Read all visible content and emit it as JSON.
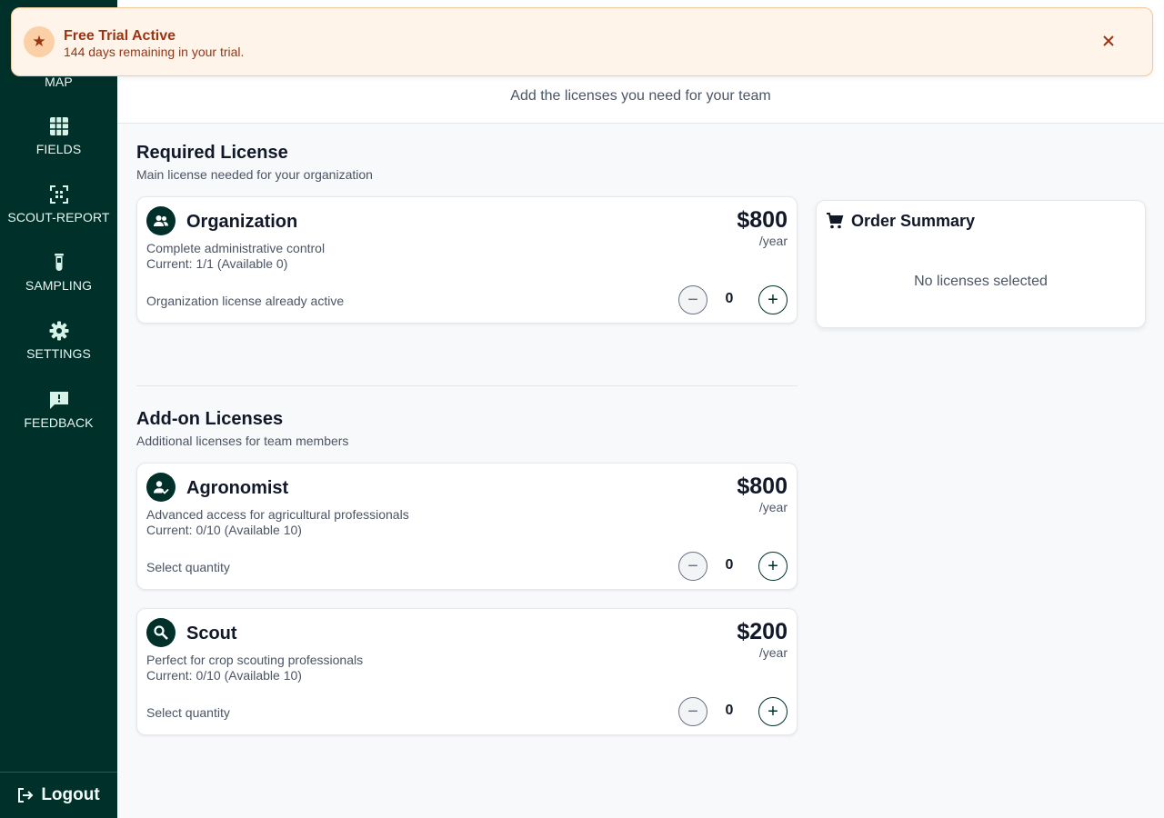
{
  "banner": {
    "title": "Free Trial Active",
    "text": "144 days remaining in your trial.",
    "icon": "star-icon",
    "close_icon": "close-icon",
    "color": "#9a3412",
    "background": "#fff4ea"
  },
  "sidebar": {
    "background": "#00302a",
    "items": [
      {
        "label": "MAP",
        "icon": "map-icon"
      },
      {
        "label": "FIELDS",
        "icon": "grid-icon"
      },
      {
        "label": "SCOUT-REPORT",
        "icon": "scan-icon"
      },
      {
        "label": "SAMPLING",
        "icon": "test-tube-icon"
      },
      {
        "label": "SETTINGS",
        "icon": "gear-icon"
      },
      {
        "label": "FEEDBACK",
        "icon": "feedback-icon"
      }
    ],
    "logout_label": "Logout",
    "logout_icon": "logout-icon"
  },
  "header": {
    "title": "",
    "subtitle": "Add the licenses you need for your team"
  },
  "required_section": {
    "title": "Required License",
    "subtitle": "Main license needed for your organization"
  },
  "addon_section": {
    "title": "Add-on Licenses",
    "subtitle": "Additional licenses for team members"
  },
  "licenses": [
    {
      "name": "Organization",
      "icon": "users-icon",
      "description": "Complete administrative control",
      "current": "Current: 1/1 (Available 0)",
      "price": "$800",
      "period": "/year",
      "status": "Organization license already active",
      "quantity": "0",
      "minus": "−",
      "plus": "+"
    },
    {
      "name": "Agronomist",
      "icon": "user-check-icon",
      "description": "Advanced access for agricultural professionals",
      "current": "Current: 0/10 (Available 10)",
      "price": "$800",
      "period": "/year",
      "status": "Select quantity",
      "quantity": "0",
      "minus": "−",
      "plus": "+"
    },
    {
      "name": "Scout",
      "icon": "search-icon",
      "description": "Perfect for crop scouting professionals",
      "current": "Current: 0/10 (Available 10)",
      "price": "$200",
      "period": "/year",
      "status": "Select quantity",
      "quantity": "0",
      "minus": "−",
      "plus": "+"
    }
  ],
  "order_summary": {
    "title": "Order Summary",
    "icon": "cart-icon",
    "empty_text": "No licenses selected"
  }
}
